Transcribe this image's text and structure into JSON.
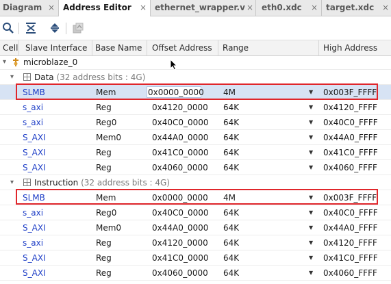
{
  "tabs": [
    {
      "label": "Diagram",
      "close": "×",
      "active": false
    },
    {
      "label": "Address Editor",
      "close": "×",
      "active": true
    },
    {
      "label": "ethernet_wrapper.v",
      "close": "×",
      "active": false
    },
    {
      "label": "eth0.xdc",
      "close": "×",
      "active": false
    },
    {
      "label": "target.xdc",
      "close": "×",
      "active": false
    }
  ],
  "toolbar": {
    "icons": [
      "search-icon",
      "collapse-all-icon",
      "expand-all-icon",
      "auto-assign-icon"
    ]
  },
  "columns": {
    "cell": "Cell",
    "slave": "Slave Interface",
    "base": "Base Name",
    "offset": "Offset Address",
    "range": "Range",
    "high": "High Address"
  },
  "tree": {
    "root": "microblaze_0",
    "data_group": {
      "name": "Data",
      "detail": "(32 address bits : 4G)"
    },
    "instruction_group": {
      "name": "Instruction",
      "detail": "(32 address bits : 4G)"
    }
  },
  "data_rows": [
    {
      "slave": "SLMB",
      "base": "Mem",
      "offset": "0x0000_0000",
      "range": "4M",
      "high": "0x003F_FFFF"
    },
    {
      "slave": "s_axi",
      "base": "Reg",
      "offset": "0x4120_0000",
      "range": "64K",
      "high": "0x4120_FFFF"
    },
    {
      "slave": "s_axi",
      "base": "Reg0",
      "offset": "0x40C0_0000",
      "range": "64K",
      "high": "0x40C0_FFFF"
    },
    {
      "slave": "S_AXI",
      "base": "Mem0",
      "offset": "0x44A0_0000",
      "range": "64K",
      "high": "0x44A0_FFFF"
    },
    {
      "slave": "S_AXI",
      "base": "Reg",
      "offset": "0x41C0_0000",
      "range": "64K",
      "high": "0x41C0_FFFF"
    },
    {
      "slave": "S_AXI",
      "base": "Reg",
      "offset": "0x4060_0000",
      "range": "64K",
      "high": "0x4060_FFFF"
    }
  ],
  "instr_rows": [
    {
      "slave": "SLMB",
      "base": "Mem",
      "offset": "0x0000_0000",
      "range": "4M",
      "high": "0x003F_FFFF"
    },
    {
      "slave": "s_axi",
      "base": "Reg0",
      "offset": "0x40C0_0000",
      "range": "64K",
      "high": "0x40C0_FFFF"
    },
    {
      "slave": "S_AXI",
      "base": "Mem0",
      "offset": "0x44A0_0000",
      "range": "64K",
      "high": "0x44A0_FFFF"
    },
    {
      "slave": "s_axi",
      "base": "Reg",
      "offset": "0x4120_0000",
      "range": "64K",
      "high": "0x4120_FFFF"
    },
    {
      "slave": "S_AXI",
      "base": "Reg",
      "offset": "0x41C0_0000",
      "range": "64K",
      "high": "0x41C0_FFFF"
    },
    {
      "slave": "S_AXI",
      "base": "Reg",
      "offset": "0x4060_0000",
      "range": "64K",
      "high": "0x4060_FFFF"
    }
  ],
  "colors": {
    "accent_highlight": "#e0262b",
    "selected_row": "#d7e3f4",
    "slave_link": "#1f3fc7"
  }
}
